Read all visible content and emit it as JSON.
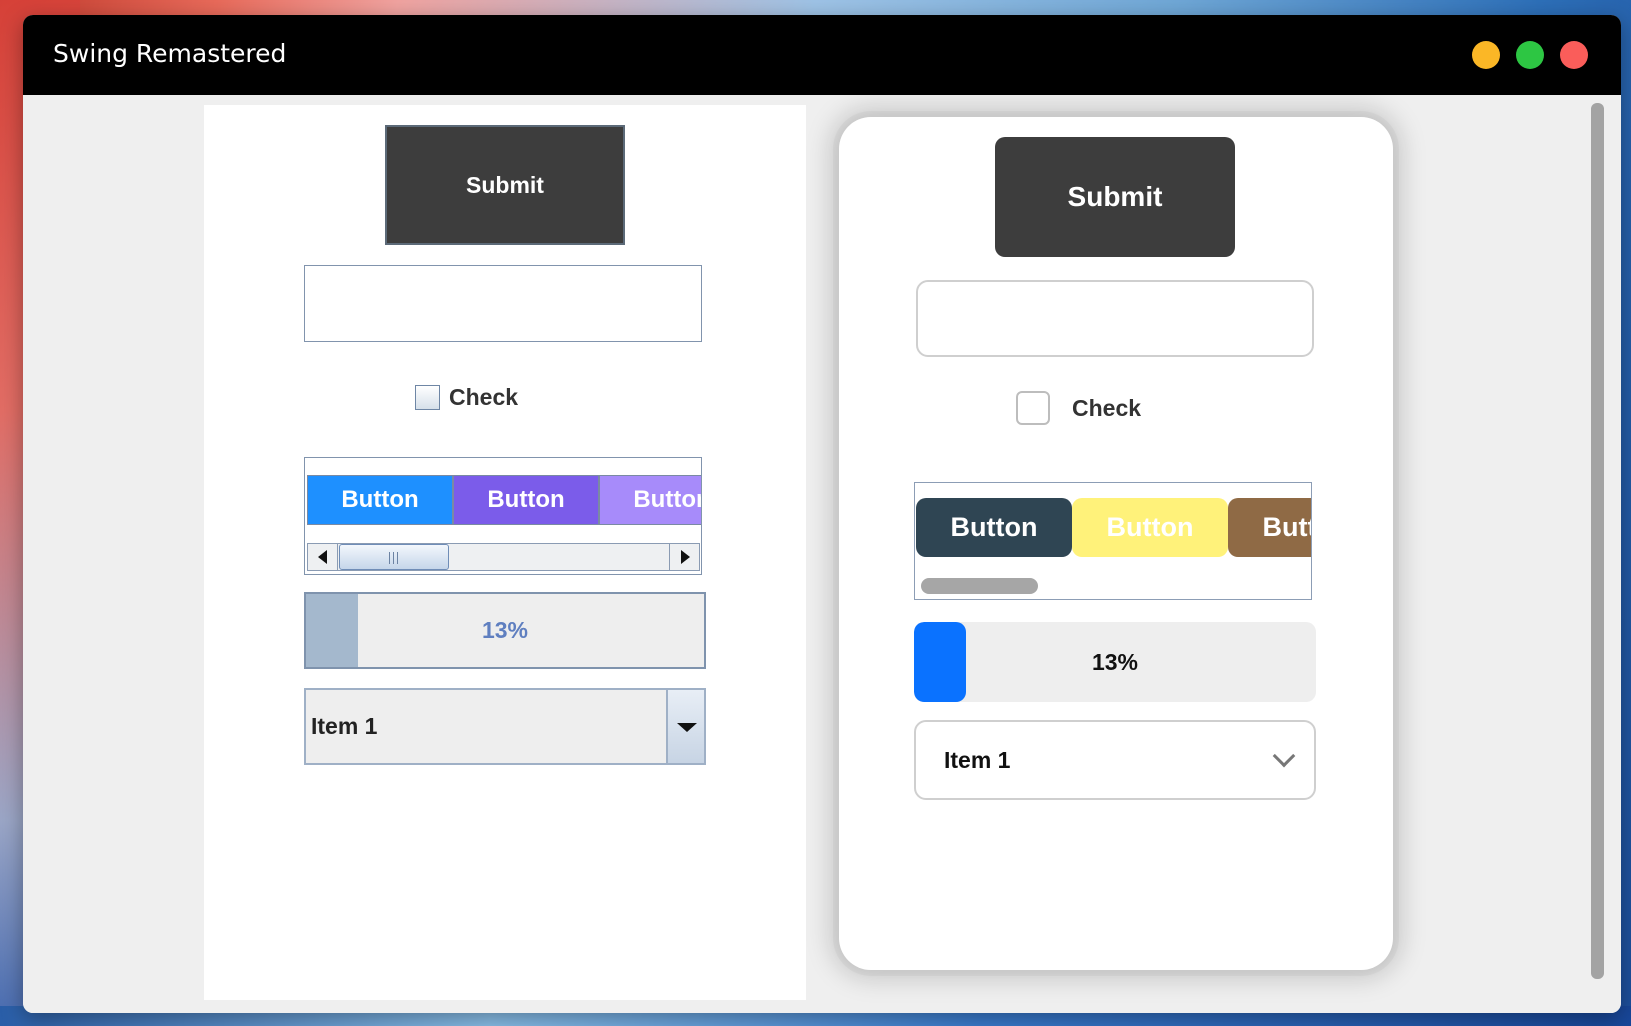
{
  "window": {
    "title": "Swing Remastered",
    "controls": [
      "minimize",
      "maximize",
      "close"
    ]
  },
  "classic": {
    "submit_label": "Submit",
    "text_field_value": "",
    "checkbox_label": "Check",
    "checkbox_checked": false,
    "buttons": [
      {
        "label": "Button",
        "color": "#1e90ff"
      },
      {
        "label": "Button",
        "color": "#7b5cea"
      },
      {
        "label": "Button",
        "color": "#a78bfa"
      }
    ],
    "progress": {
      "value": 13,
      "label": "13%"
    },
    "combo_value": "Item 1"
  },
  "modern": {
    "submit_label": "Submit",
    "text_field_value": "",
    "checkbox_label": "Check",
    "checkbox_checked": false,
    "buttons": [
      {
        "label": "Button",
        "color": "#2f4553"
      },
      {
        "label": "Button",
        "color": "#fff27a"
      },
      {
        "label": "Button",
        "color": "#8f6a45"
      }
    ],
    "progress": {
      "value": 13,
      "label": "13%",
      "color": "#0a72ff"
    },
    "combo_value": "Item 1"
  }
}
